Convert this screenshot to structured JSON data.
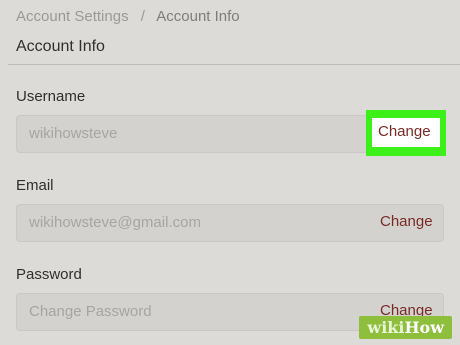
{
  "breadcrumb": {
    "parent": "Account Settings",
    "separator": "/",
    "current": "Account Info"
  },
  "page": {
    "title": "Account Info"
  },
  "fields": [
    {
      "label": "Username",
      "value": "wikihowsteve",
      "action": "Change"
    },
    {
      "label": "Email",
      "value": "wikihowsteve@gmail.com",
      "action": "Change"
    },
    {
      "label": "Password",
      "value": "Change Password",
      "action": "Change"
    }
  ],
  "watermark": {
    "wiki": "wiki",
    "how": "How"
  },
  "colors": {
    "background": "#dcdbd8",
    "link": "#7a2a23",
    "highlight": "#3ef01a",
    "watermark": "#8dbe3c"
  }
}
